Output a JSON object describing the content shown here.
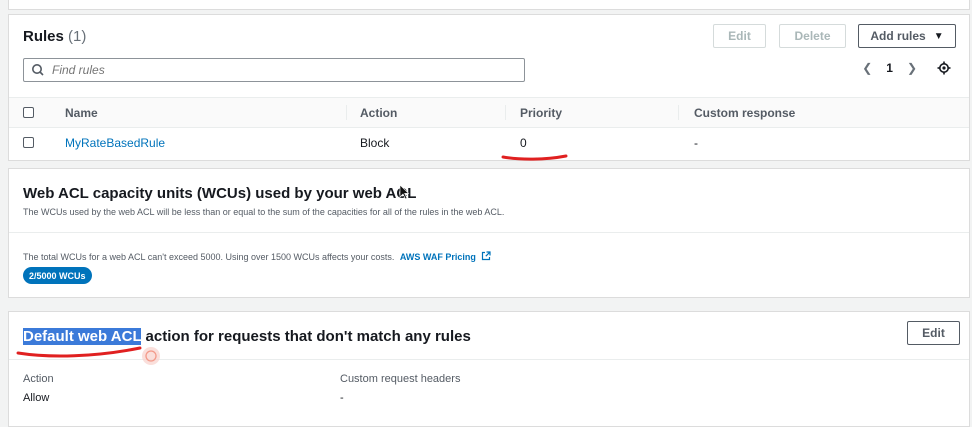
{
  "rules": {
    "title": "Rules",
    "count": "(1)",
    "buttons": {
      "edit": "Edit",
      "delete": "Delete",
      "add_rules": "Add rules"
    },
    "search_placeholder": "Find rules",
    "page": "1",
    "columns": [
      "Name",
      "Action",
      "Priority",
      "Custom response"
    ],
    "rows": [
      {
        "name": "MyRateBasedRule",
        "action": "Block",
        "priority": "0",
        "custom_response": "-"
      }
    ]
  },
  "wcu": {
    "title": "Web ACL capacity units (WCUs) used by your web ACL",
    "description": "The WCUs used by the web ACL will be less than or equal to the sum of the capacities for all of the rules in the web ACL.",
    "note": "The total WCUs for a web ACL can't exceed 5000. Using over 1500 WCUs affects your costs.",
    "pricing_link": "AWS WAF Pricing",
    "badge": "2/5000 WCUs"
  },
  "default_acl": {
    "title_highlight": "Default web ACL",
    "title_rest": " action for requests that don't match any rules",
    "edit": "Edit",
    "action_label": "Action",
    "action_value": "Allow",
    "headers_label": "Custom request headers",
    "headers_value": "-"
  },
  "colors": {
    "link": "#0073bb",
    "annotation": "#e02020",
    "badge": "#0073bb"
  }
}
